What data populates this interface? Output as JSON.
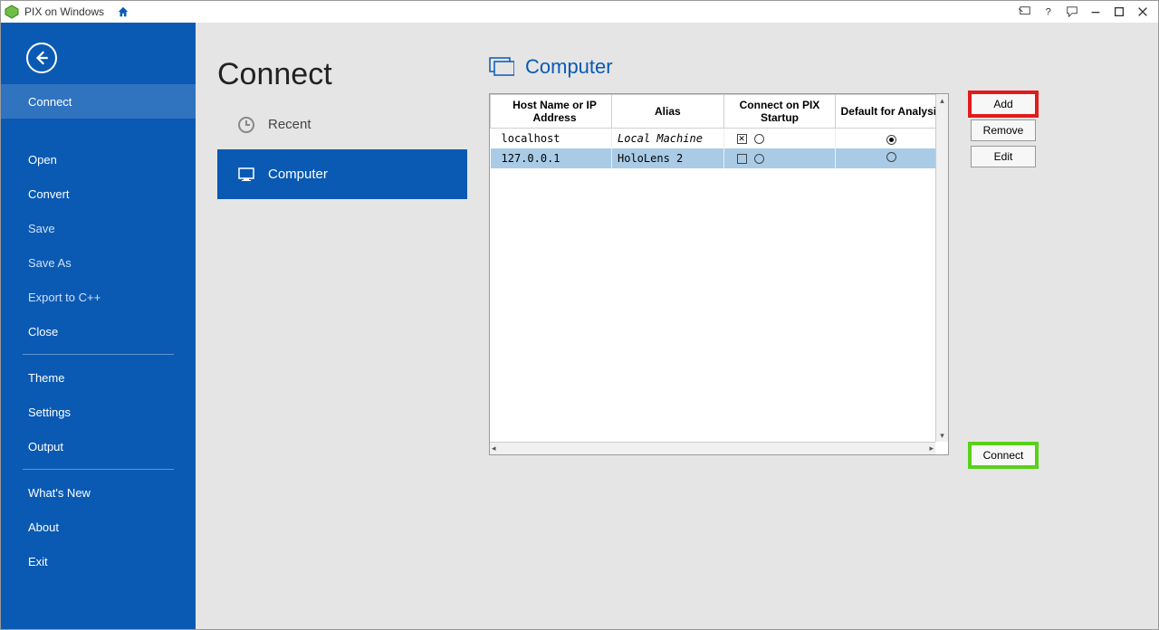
{
  "app": {
    "title": "PIX on Windows"
  },
  "sidebar": {
    "items": [
      {
        "id": "connect",
        "label": "Connect",
        "selected": true,
        "dim": false
      },
      {
        "id": "open",
        "label": "Open",
        "selected": false,
        "dim": false
      },
      {
        "id": "convert",
        "label": "Convert",
        "selected": false,
        "dim": false
      },
      {
        "id": "save",
        "label": "Save",
        "selected": false,
        "dim": true
      },
      {
        "id": "saveas",
        "label": "Save As",
        "selected": false,
        "dim": true
      },
      {
        "id": "exportcpp",
        "label": "Export to C++",
        "selected": false,
        "dim": true
      },
      {
        "id": "close",
        "label": "Close",
        "selected": false,
        "dim": false
      },
      {
        "id": "theme",
        "label": "Theme",
        "selected": false,
        "dim": false
      },
      {
        "id": "settings",
        "label": "Settings",
        "selected": false,
        "dim": false
      },
      {
        "id": "output",
        "label": "Output",
        "selected": false,
        "dim": false
      },
      {
        "id": "whatsnew",
        "label": "What's New",
        "selected": false,
        "dim": false
      },
      {
        "id": "about",
        "label": "About",
        "selected": false,
        "dim": false
      },
      {
        "id": "exit",
        "label": "Exit",
        "selected": false,
        "dim": false
      }
    ]
  },
  "page": {
    "title": "Connect"
  },
  "midnav": {
    "items": [
      {
        "id": "recent",
        "label": "Recent",
        "selected": false
      },
      {
        "id": "computer",
        "label": "Computer",
        "selected": true
      }
    ]
  },
  "computer": {
    "title": "Computer",
    "columns": {
      "host": "Host Name or IP Address",
      "alias": "Alias",
      "connect": "Connect on PIX Startup",
      "default": "Default for Analysis"
    },
    "rows": [
      {
        "host": "localhost",
        "alias": "Local Machine",
        "connect_checked": true,
        "connect_radio": false,
        "default_radio": true,
        "selected": false
      },
      {
        "host": "127.0.0.1",
        "alias": "HoloLens 2",
        "connect_checked": false,
        "connect_radio": false,
        "default_radio": false,
        "selected": true
      }
    ],
    "buttons": {
      "add": "Add",
      "remove": "Remove",
      "edit": "Edit",
      "connect": "Connect"
    }
  }
}
